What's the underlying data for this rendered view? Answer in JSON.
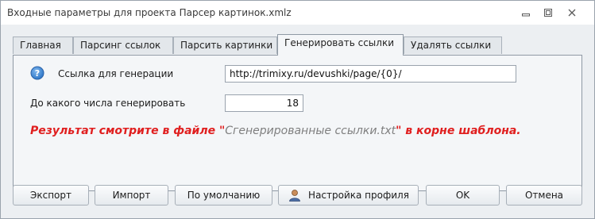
{
  "window": {
    "title": "Входные параметры для проекта Парсер картинок.xmlz"
  },
  "tabs": [
    {
      "label": "Главная",
      "active": false
    },
    {
      "label": "Парсинг ссылок",
      "active": false
    },
    {
      "label": "Парсить картинки",
      "active": false
    },
    {
      "label": "Генерировать ссылки",
      "active": true
    },
    {
      "label": "Удалять ссылки",
      "active": false
    }
  ],
  "form": {
    "link_label": "Ссылка для генерации",
    "link_value": "http://trimixy.ru/devushki/page/{0}/",
    "count_label": "До какого числа генерировать",
    "count_value": "18",
    "note_prefix": "Результат смотрите в файле \"",
    "note_file": "Сгенерированные ссылки.txt",
    "note_suffix": "\" в корне шаблона."
  },
  "buttons": {
    "export": "Экспорт",
    "import": "Импорт",
    "default": "По умолчанию",
    "profile": "Настройка профиля",
    "ok": "OK",
    "cancel": "Отмена"
  },
  "colors": {
    "note": "#e01f1f",
    "help_icon": "#2f78c8"
  }
}
